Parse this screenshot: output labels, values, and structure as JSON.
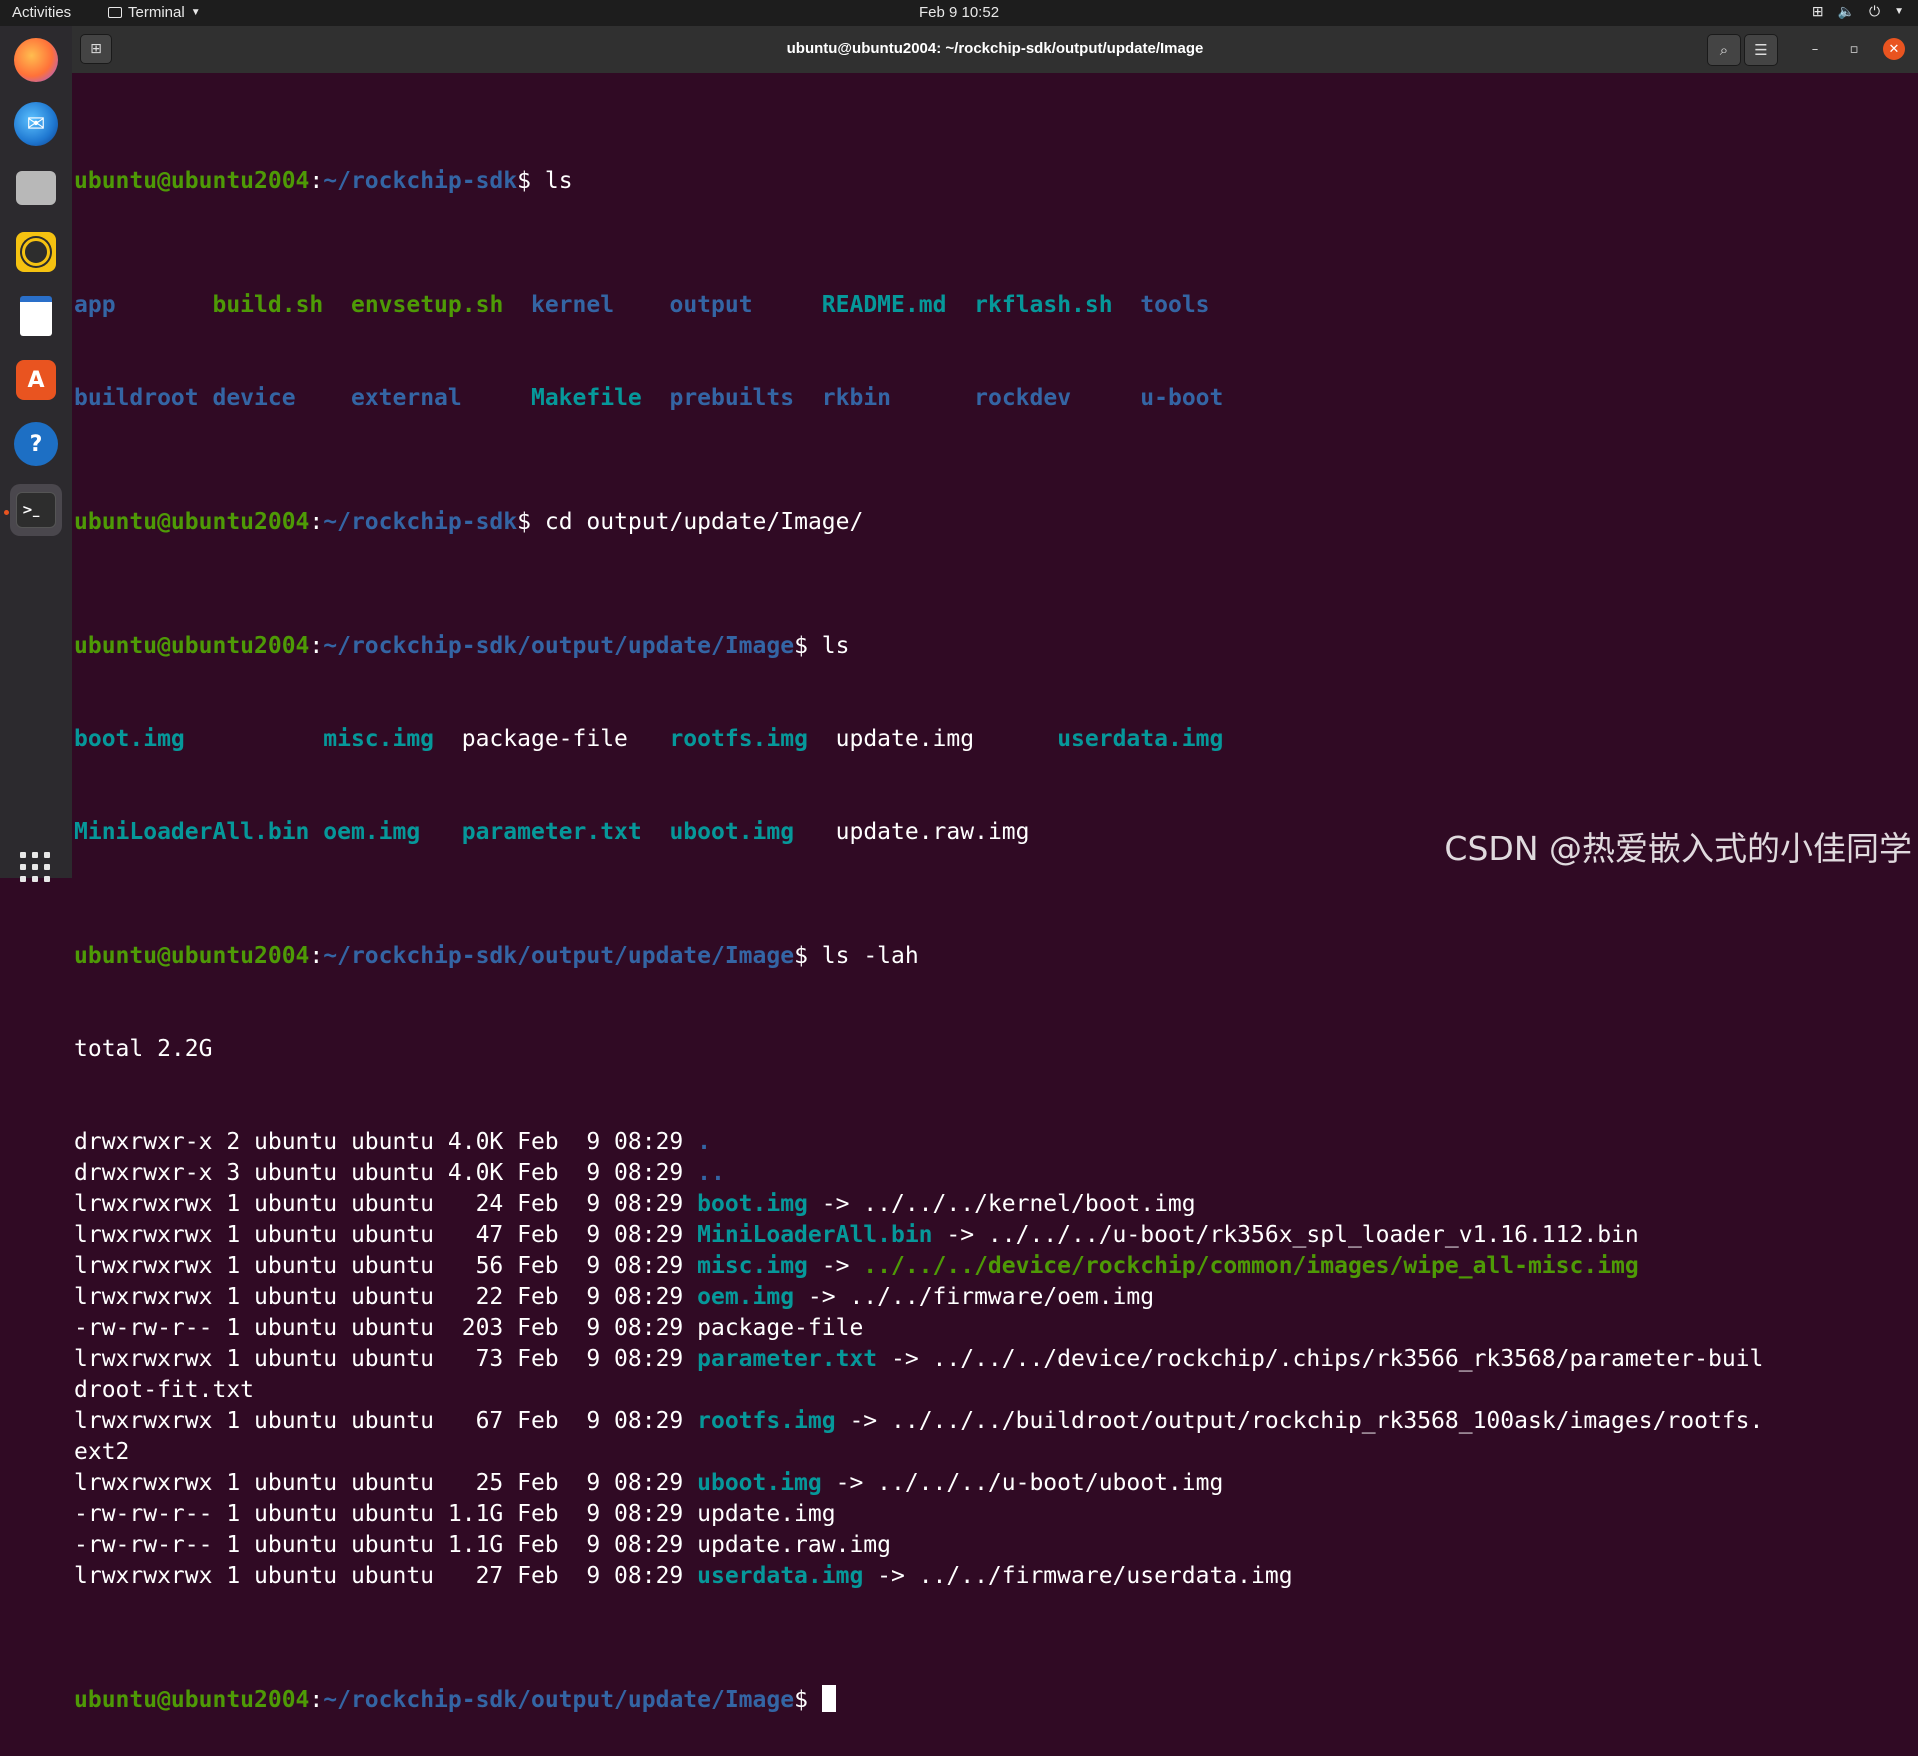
{
  "topbar": {
    "activities": "Activities",
    "app_name": "Terminal",
    "clock": "Feb 9  10:52",
    "tray": {
      "network_icon": "network-icon",
      "volume_icon": "volume-icon",
      "power_icon": "power-icon"
    }
  },
  "dock": {
    "items": [
      "firefox",
      "thunderbird",
      "files",
      "rhythmbox",
      "libreoffice-writer",
      "ubuntu-software",
      "help",
      "terminal"
    ],
    "colors": {
      "firefox": "#ff7139",
      "thunderbird": "#1f78d1",
      "files": "#9b9b9b",
      "rhythmbox": "#f5c211",
      "writer": "#2a6fc9",
      "software": "#e95420",
      "help": "#1d6fc4",
      "terminal": "#2d2d2d"
    }
  },
  "window": {
    "title": "ubuntu@ubuntu2004: ~/rockchip-sdk/output/update/Image"
  },
  "colors": {
    "background": "#300a24",
    "prompt_user": "#4e9a06",
    "prompt_path": "#3465a4",
    "directory": "#3465a4",
    "symlink": "#06989a",
    "accent": "#e95420"
  },
  "terminal": {
    "prompt_user": "ubuntu@ubuntu2004",
    "prompt_sep": ":",
    "home_path": "~/rockchip-sdk",
    "image_path": "~/rockchip-sdk/output/update/Image",
    "cmd_ls": "ls",
    "cmd_cd": "cd output/update/Image/",
    "cmd_ls_lah": "ls -lah",
    "sdk_listing": {
      "row1": [
        "app       ",
        "build.sh  ",
        "envsetup.sh  ",
        "kernel    ",
        "output     ",
        "README.md  ",
        "rkflash.sh  ",
        "tools"
      ],
      "row2": [
        "buildroot ",
        "device    ",
        "external     ",
        "Makefile  ",
        "prebuilts  ",
        "rkbin      ",
        "rockdev     ",
        "u-boot"
      ]
    },
    "image_listing": {
      "row1": [
        "boot.img          ",
        "misc.img  ",
        "package-file   ",
        "rootfs.img  ",
        "update.img      ",
        "userdata.img"
      ],
      "row2": [
        "MiniLoaderAll.bin ",
        "oem.img   ",
        "parameter.txt  ",
        "uboot.img   ",
        "update.raw.img"
      ]
    },
    "total": "total 2.2G",
    "entries": [
      {
        "meta": "drwxrwxr-x 2 ubuntu ubuntu 4.0K Feb  9 08:29 ",
        "name": ".",
        "cls": "d",
        "arrow": "",
        "target": "",
        "tcls": ""
      },
      {
        "meta": "drwxrwxr-x 3 ubuntu ubuntu 4.0K Feb  9 08:29 ",
        "name": "..",
        "cls": "d",
        "arrow": "",
        "target": "",
        "tcls": ""
      },
      {
        "meta": "lrwxrwxrwx 1 ubuntu ubuntu   24 Feb  9 08:29 ",
        "name": "boot.img",
        "cls": "c",
        "arrow": " -> ",
        "target": "../../../kernel/boot.img",
        "tcls": ""
      },
      {
        "meta": "lrwxrwxrwx 1 ubuntu ubuntu   47 Feb  9 08:29 ",
        "name": "MiniLoaderAll.bin",
        "cls": "c",
        "arrow": " -> ",
        "target": "../../../u-boot/rk356x_spl_loader_v1.16.112.bin",
        "tcls": ""
      },
      {
        "meta": "lrwxrwxrwx 1 ubuntu ubuntu   56 Feb  9 08:29 ",
        "name": "misc.img",
        "cls": "c",
        "arrow": " -> ",
        "target": "../../../device/rockchip/common/images/wipe_all-misc.img",
        "tcls": "g"
      },
      {
        "meta": "lrwxrwxrwx 1 ubuntu ubuntu   22 Feb  9 08:29 ",
        "name": "oem.img",
        "cls": "c",
        "arrow": " -> ",
        "target": "../../firmware/oem.img",
        "tcls": ""
      },
      {
        "meta": "-rw-rw-r-- 1 ubuntu ubuntu  203 Feb  9 08:29 ",
        "name": "package-file",
        "cls": "",
        "arrow": "",
        "target": "",
        "tcls": ""
      },
      {
        "meta": "lrwxrwxrwx 1 ubuntu ubuntu   73 Feb  9 08:29 ",
        "name": "parameter.txt",
        "cls": "c",
        "arrow": " -> ",
        "target": "../../../device/rockchip/.chips/rk3566_rk3568/parameter-buil",
        "tcls": ""
      },
      {
        "meta": "",
        "name": "",
        "cls": "",
        "arrow": "",
        "target": "droot-fit.txt",
        "tcls": ""
      },
      {
        "meta": "lrwxrwxrwx 1 ubuntu ubuntu   67 Feb  9 08:29 ",
        "name": "rootfs.img",
        "cls": "c",
        "arrow": " -> ",
        "target": "../../../buildroot/output/rockchip_rk3568_100ask/images/rootfs.",
        "tcls": ""
      },
      {
        "meta": "",
        "name": "",
        "cls": "",
        "arrow": "",
        "target": "ext2",
        "tcls": ""
      },
      {
        "meta": "lrwxrwxrwx 1 ubuntu ubuntu   25 Feb  9 08:29 ",
        "name": "uboot.img",
        "cls": "c",
        "arrow": " -> ",
        "target": "../../../u-boot/uboot.img",
        "tcls": ""
      },
      {
        "meta": "-rw-rw-r-- 1 ubuntu ubuntu 1.1G Feb  9 08:29 ",
        "name": "update.img",
        "cls": "",
        "arrow": "",
        "target": "",
        "tcls": ""
      },
      {
        "meta": "-rw-rw-r-- 1 ubuntu ubuntu 1.1G Feb  9 08:29 ",
        "name": "update.raw.img",
        "cls": "",
        "arrow": "",
        "target": "",
        "tcls": ""
      },
      {
        "meta": "lrwxrwxrwx 1 ubuntu ubuntu   27 Feb  9 08:29 ",
        "name": "userdata.img",
        "cls": "c",
        "arrow": " -> ",
        "target": "../../firmware/userdata.img",
        "tcls": ""
      }
    ]
  },
  "watermark": "CSDN @热爱嵌入式的小佳同学"
}
